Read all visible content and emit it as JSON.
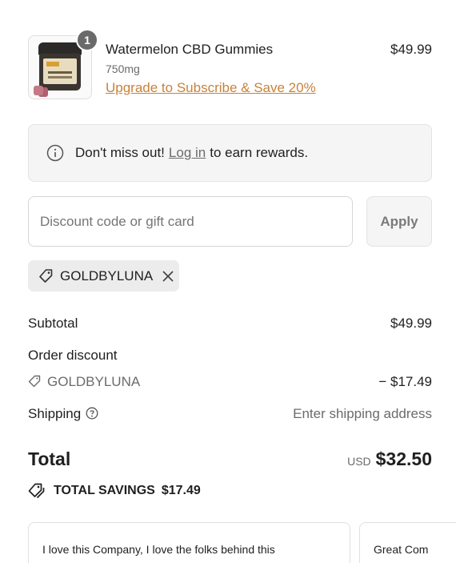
{
  "product": {
    "title": "Watermelon CBD Gummies",
    "variant": "750mg",
    "upgrade_link": "Upgrade to Subscribe & Save 20%",
    "price": "$49.99",
    "quantity": "1"
  },
  "notice": {
    "prefix": "Don't miss out!",
    "link": "Log in",
    "suffix": "to earn rewards."
  },
  "discount": {
    "placeholder": "Discount code or gift card",
    "apply_label": "Apply",
    "applied_code": "GOLDBYLUNA"
  },
  "summary": {
    "subtotal_label": "Subtotal",
    "subtotal_value": "$49.99",
    "order_discount_label": "Order discount",
    "discount_code": "GOLDBYLUNA",
    "discount_value": "− $17.49",
    "shipping_label": "Shipping",
    "shipping_value": "Enter shipping address",
    "total_label": "Total",
    "currency": "USD",
    "total_value": "$32.50",
    "savings_label": "TOTAL SAVINGS",
    "savings_value": "$17.49"
  },
  "reviews": [
    {
      "text": "I love this Company, I love the folks behind this"
    },
    {
      "text": "Great Com"
    }
  ],
  "colors": {
    "accent_link": "#c8823a",
    "badge": "#6a6a6a"
  },
  "icons": {
    "info": "info-icon",
    "tag": "tag-icon",
    "close": "close-icon",
    "help": "help-icon",
    "tags": "tags-icon"
  }
}
